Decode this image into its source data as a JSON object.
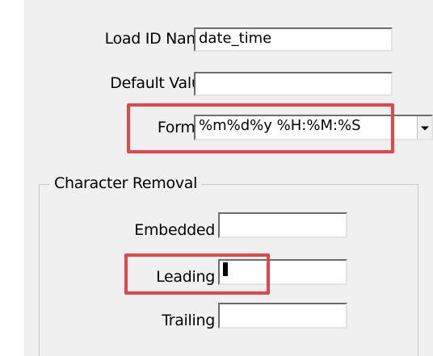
{
  "fields": {
    "load_id_name": {
      "label": "Load ID Name",
      "value": "date_time"
    },
    "default_value": {
      "label": "Default Value",
      "value": ""
    },
    "format": {
      "label": "Format",
      "value": "%m%d%y %H:%M:%S"
    }
  },
  "character_removal": {
    "title": "Character Removal",
    "embedded": {
      "label": "Embedded",
      "value": ""
    },
    "leading": {
      "label": "Leading",
      "value": ""
    },
    "trailing": {
      "label": "Trailing",
      "value": ""
    }
  },
  "icons": {
    "dropdown": "chevron-down-icon"
  },
  "colors": {
    "highlight": "#e0474c",
    "panel": "#f0f0f0"
  }
}
